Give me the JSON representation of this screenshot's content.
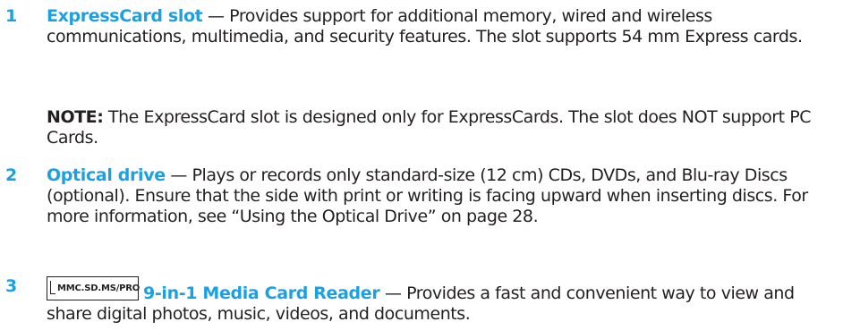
{
  "items": [
    {
      "number": "1",
      "term": "ExpressCard slot",
      "description": " — Provides support for additional memory, wired and wireless communications, multimedia, and security features. The slot supports 54 mm Express cards.",
      "note_label": "NOTE:",
      "note_text": " The ExpressCard slot is designed only for ExpressCards. The slot does NOT support PC Cards."
    },
    {
      "number": "2",
      "term": "Optical drive",
      "description": " — Plays or records only standard-size (12 cm) CDs, DVDs, and Blu-ray Discs (optional). Ensure that the side with print or writing is facing upward when inserting discs. For more information, see “Using the Optical Drive” on page 28."
    },
    {
      "number": "3",
      "icon_name": "media-card-reader-icon",
      "icon_text": "MMC.SD.MS/PRO",
      "term": "9-in-1 Media Card Reader",
      "description": " — Provides a fast and convenient way to view and share digital photos, music, videos, and documents."
    }
  ],
  "colors": {
    "accent": "#1ba1e2",
    "text": "#231f20"
  }
}
